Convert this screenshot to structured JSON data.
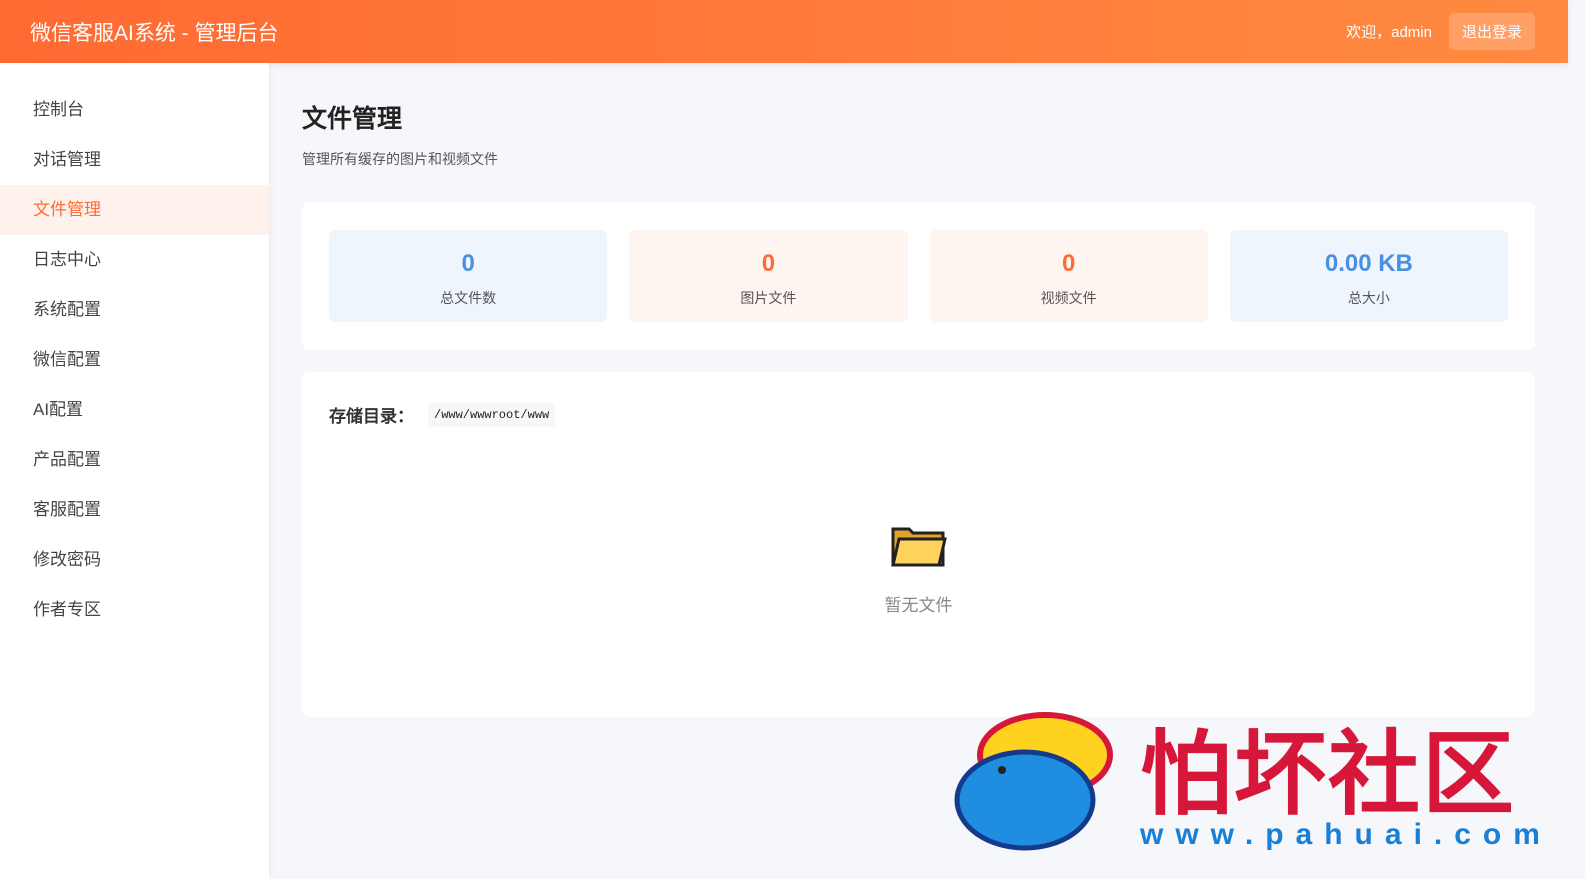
{
  "header": {
    "title": "微信客服AI系统 - 管理后台",
    "welcome": "欢迎，admin",
    "logout": "退出登录"
  },
  "sidebar": {
    "items": [
      {
        "label": "控制台"
      },
      {
        "label": "对话管理"
      },
      {
        "label": "文件管理",
        "active": true
      },
      {
        "label": "日志中心"
      },
      {
        "label": "系统配置"
      },
      {
        "label": "微信配置"
      },
      {
        "label": "AI配置"
      },
      {
        "label": "产品配置"
      },
      {
        "label": "客服配置"
      },
      {
        "label": "修改密码"
      },
      {
        "label": "作者专区"
      }
    ]
  },
  "page": {
    "title": "文件管理",
    "subtitle": "管理所有缓存的图片和视频文件"
  },
  "stats": [
    {
      "value": "0",
      "label": "总文件数",
      "color": "#4a90e2",
      "bg": "#eef5fd"
    },
    {
      "value": "0",
      "label": "图片文件",
      "color": "#ff6b35",
      "bg": "#fff5f0"
    },
    {
      "value": "0",
      "label": "视频文件",
      "color": "#ff6b35",
      "bg": "#fff5f0"
    },
    {
      "value": "0.00 KB",
      "label": "总大小",
      "color": "#4a90e2",
      "bg": "#eef5fd"
    }
  ],
  "storage": {
    "label": "存储目录：",
    "path": "/www/wwwroot/www"
  },
  "empty": {
    "icon": "folder-icon",
    "text": "暂无文件"
  },
  "watermark": {
    "text": "怕坏社区",
    "url": "www.pahuai.com"
  }
}
